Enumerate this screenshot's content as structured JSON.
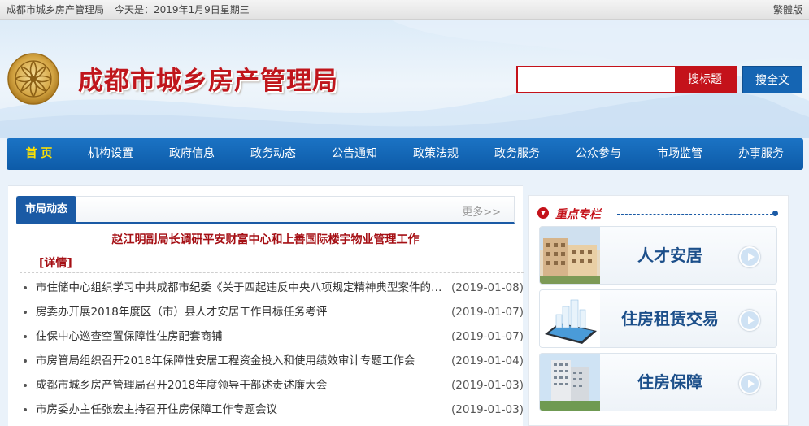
{
  "topbar": {
    "site_name": "成都市城乡房产管理局",
    "today": "今天是：2019年1月9日星期三",
    "traditional": "繁體版"
  },
  "header": {
    "title": "成都市城乡房产管理局",
    "search_placeholder": "",
    "search_title_button": "搜标题",
    "search_full_button": "搜全文"
  },
  "nav": {
    "items": [
      {
        "label": "首  页",
        "active": true
      },
      {
        "label": "机构设置"
      },
      {
        "label": "政府信息"
      },
      {
        "label": "政务动态"
      },
      {
        "label": "公告通知"
      },
      {
        "label": "政策法规"
      },
      {
        "label": "政务服务"
      },
      {
        "label": "公众参与"
      },
      {
        "label": "市场监管"
      },
      {
        "label": "办事服务"
      }
    ]
  },
  "news": {
    "tab_label": "市局动态",
    "more_label": "更多>>",
    "headline": "赵江明副局长调研平安财富中心和上善国际楼宇物业管理工作",
    "detail_label": "[详情]",
    "items": [
      {
        "text": "市住储中心组织学习中共成都市纪委《关于四起违反中央八项规定精神典型案件的通报》",
        "date": "(2019-01-08)"
      },
      {
        "text": "房委办开展2018年度区（市）县人才安居工作目标任务考评",
        "date": "(2019-01-07)"
      },
      {
        "text": "住保中心巡查空置保障性住房配套商铺",
        "date": "(2019-01-07)"
      },
      {
        "text": "市房管局组织召开2018年保障性安居工程资金投入和使用绩效审计专题工作会",
        "date": "(2019-01-04)"
      },
      {
        "text": "成都市城乡房产管理局召开2018年度领导干部述责述廉大会",
        "date": "(2019-01-03)"
      },
      {
        "text": "市房委办主任张宏主持召开住房保障工作专题会议",
        "date": "(2019-01-03)"
      }
    ]
  },
  "side": {
    "title": "重点专栏",
    "cards": [
      {
        "label": "人才安居"
      },
      {
        "label": "住房租赁交易"
      },
      {
        "label": "住房保障"
      }
    ]
  },
  "colors": {
    "brand_red": "#c4121a",
    "nav_blue": "#1565b3",
    "nav_active": "#ffe200"
  }
}
